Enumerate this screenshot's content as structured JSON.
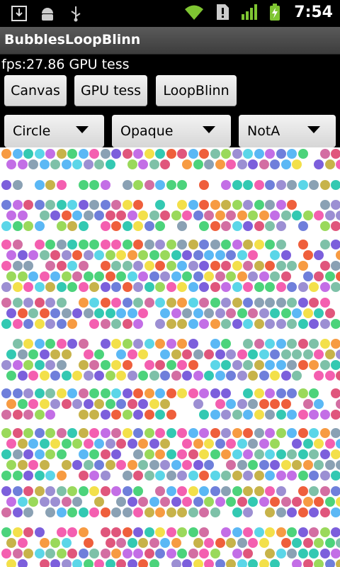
{
  "status_bar": {
    "left_icons": [
      "download-icon",
      "android-debug-icon",
      "usb-icon"
    ],
    "right_icons": [
      "wifi-icon",
      "notification-alert-icon",
      "signal-icon",
      "battery-charging-icon"
    ],
    "time": "7:54"
  },
  "app": {
    "title": "BubblesLoopBlinn"
  },
  "fps_text": "fps:27.86 GPU tess",
  "buttons": [
    {
      "label": "Canvas"
    },
    {
      "label": "GPU tess"
    },
    {
      "label": "LoopBlinn"
    }
  ],
  "spinners": [
    {
      "value": "Circle"
    },
    {
      "value": "Opaque"
    },
    {
      "value": "NotA"
    }
  ],
  "colors": {
    "bubble_palette": [
      "#7c5fdc",
      "#4cd37b",
      "#f45fb0",
      "#f3e04a",
      "#5bb8f5",
      "#ef5f3c",
      "#9ad95b",
      "#c36ee6",
      "#8aa1b4",
      "#33c9b2",
      "#f79b42",
      "#6f7fdb",
      "#d36ea2",
      "#7ec1a8",
      "#c7b34a",
      "#5bd6e8",
      "#9c8fd3",
      "#e0567c"
    ]
  }
}
